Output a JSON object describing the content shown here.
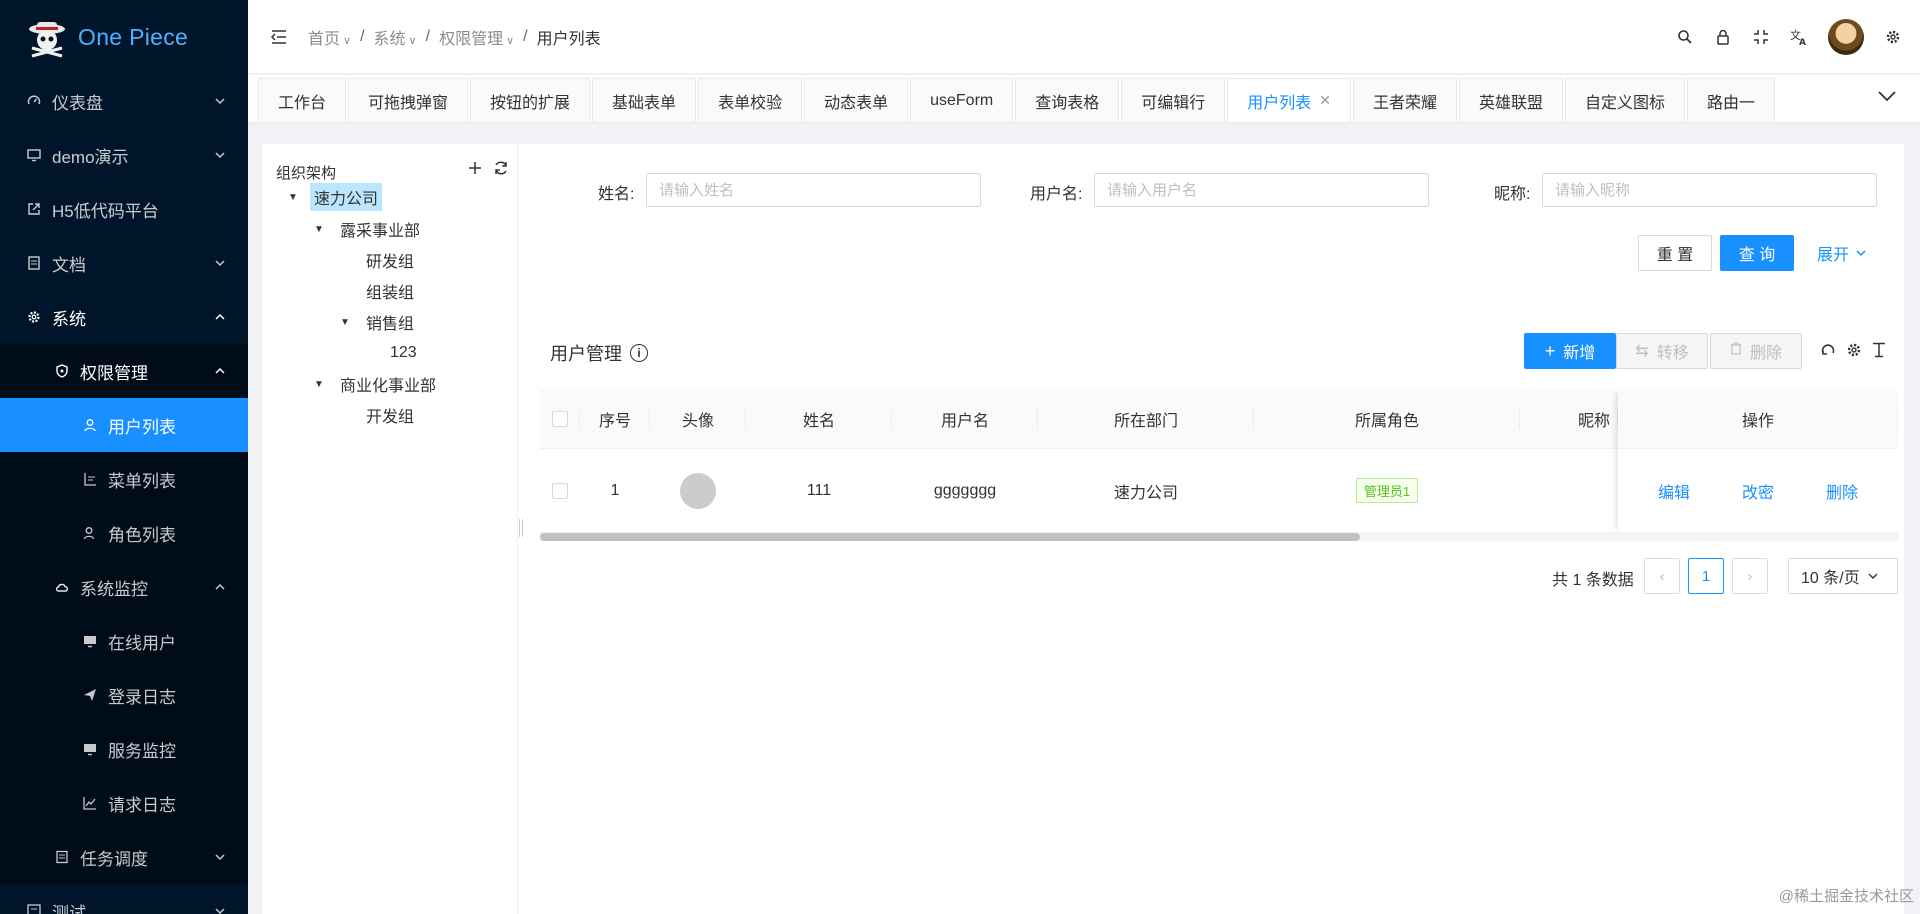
{
  "app": {
    "name": "One Piece"
  },
  "sidebar": {
    "items": [
      {
        "label": "仪表盘",
        "icon": "dashboard-icon",
        "arrow": "down"
      },
      {
        "label": "demo演示",
        "icon": "monitor-icon",
        "arrow": "down"
      },
      {
        "label": "H5低代码平台",
        "icon": "external-link-icon",
        "arrow": ""
      },
      {
        "label": "文档",
        "icon": "document-icon",
        "arrow": "down"
      },
      {
        "label": "系统",
        "icon": "gear-icon",
        "arrow": "up"
      },
      {
        "label": "权限管理",
        "icon": "shield-icon",
        "arrow": "up"
      },
      {
        "label": "用户列表",
        "icon": "user-icon",
        "arrow": ""
      },
      {
        "label": "菜单列表",
        "icon": "list-icon",
        "arrow": ""
      },
      {
        "label": "角色列表",
        "icon": "role-icon",
        "arrow": ""
      },
      {
        "label": "系统监控",
        "icon": "cloud-icon",
        "arrow": "up"
      },
      {
        "label": "在线用户",
        "icon": "screen-icon",
        "arrow": ""
      },
      {
        "label": "登录日志",
        "icon": "send-icon",
        "arrow": ""
      },
      {
        "label": "服务监控",
        "icon": "screen-icon",
        "arrow": ""
      },
      {
        "label": "请求日志",
        "icon": "chart-icon",
        "arrow": ""
      },
      {
        "label": "任务调度",
        "icon": "calendar-icon",
        "arrow": "down"
      },
      {
        "label": "测试",
        "icon": "test-icon",
        "arrow": "down"
      }
    ]
  },
  "breadcrumb": {
    "home": "首页",
    "system": "系统",
    "permission": "权限管理",
    "current": "用户列表"
  },
  "tabs": [
    "工作台",
    "可拖拽弹窗",
    "按钮的扩展",
    "基础表单",
    "表单校验",
    "动态表单",
    "useForm",
    "查询表格",
    "可编辑行",
    "用户列表",
    "王者荣耀",
    "英雄联盟",
    "自定义图标",
    "路由一"
  ],
  "tree": {
    "title": "组织架构",
    "nodes": [
      "速力公司",
      "露采事业部",
      "研发组",
      "组装组",
      "销售组",
      "123",
      "商业化事业部",
      "开发组"
    ]
  },
  "search": {
    "name_label": "姓名:",
    "name_placeholder": "请输入姓名",
    "username_label": "用户名:",
    "username_placeholder": "请输入用户名",
    "nickname_label": "昵称:",
    "nickname_placeholder": "请输入昵称",
    "reset": "重 置",
    "query": "查 询",
    "expand": "展开"
  },
  "table": {
    "title": "用户管理",
    "add": "新增",
    "transfer": "转移",
    "delete": "删除",
    "columns": [
      "序号",
      "头像",
      "姓名",
      "用户名",
      "所在部门",
      "所属角色",
      "昵称",
      "操作"
    ],
    "rows": [
      {
        "index": "1",
        "name": "111",
        "username": "ggggggg",
        "dept": "速力公司",
        "role": "管理员1",
        "nickname": "",
        "ops": [
          "编辑",
          "改密",
          "删除"
        ]
      }
    ]
  },
  "pagination": {
    "total": "共 1 条数据",
    "page": "1",
    "page_size": "10 条/页"
  },
  "watermark": "@稀土掘金技术社区"
}
